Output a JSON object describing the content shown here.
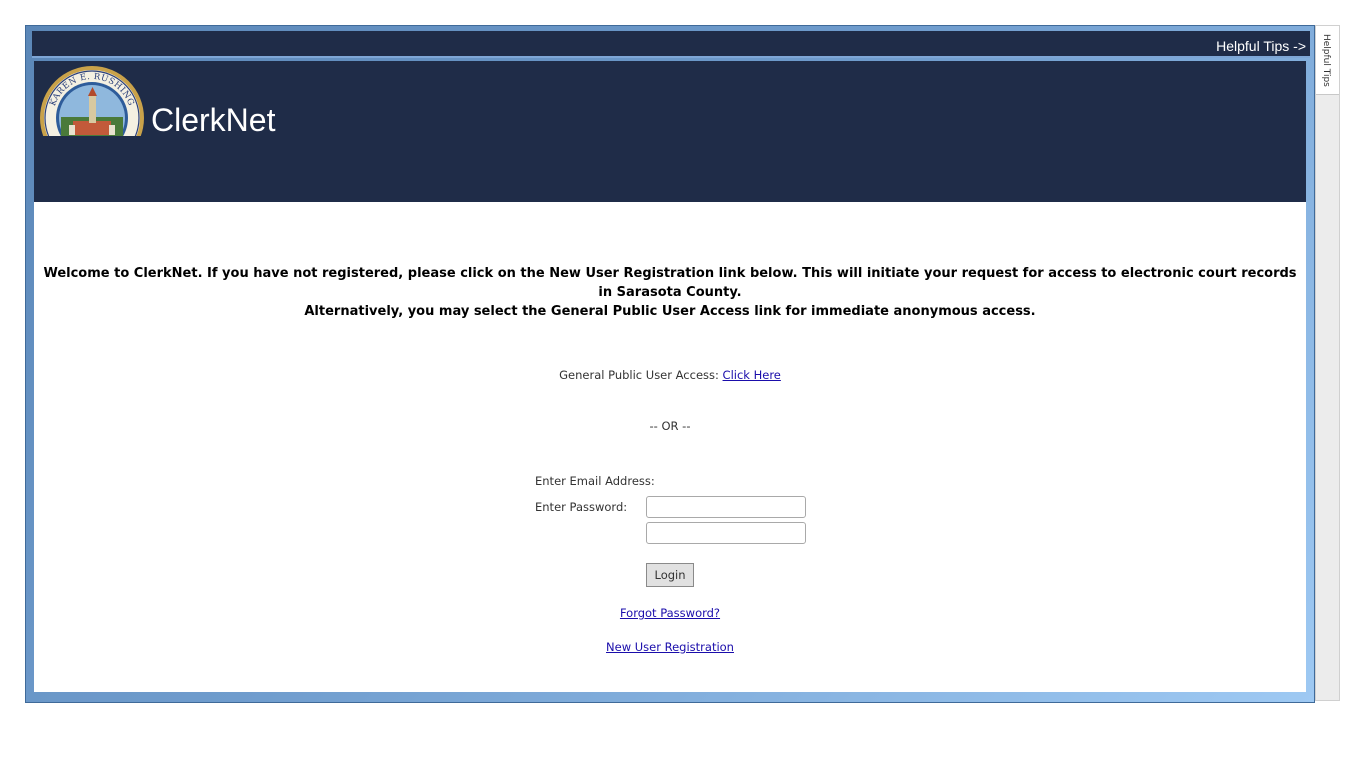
{
  "tips_bar": {
    "label": "Helpful Tips ->"
  },
  "header": {
    "brand": "ClerkNet",
    "seal": {
      "name": "KAREN E. RUSHING"
    }
  },
  "welcome": {
    "line1": "Welcome to ClerkNet. If you have not registered, please click on the New User Registration link below. This will initiate your request for access to electronic court records in Sarasota County.",
    "line2": "Alternatively, you may select the General Public User Access link for immediate anonymous access."
  },
  "public_access": {
    "label": "General Public User Access:",
    "link": "Click Here"
  },
  "or_text": "-- OR --",
  "login_form": {
    "email_label": "Enter Email Address:",
    "email_value": "",
    "password_label": "Enter Password:",
    "password_value": "",
    "login_button": "Login"
  },
  "links": {
    "forgot_password": "Forgot Password?",
    "new_user_registration": "New User Registration"
  },
  "side_panel": {
    "tab_label": "Helpful Tips"
  },
  "colors": {
    "header_navy": "#1f2c48",
    "frame_blue": "#6f9ccd",
    "link_blue": "#1a0dab"
  }
}
